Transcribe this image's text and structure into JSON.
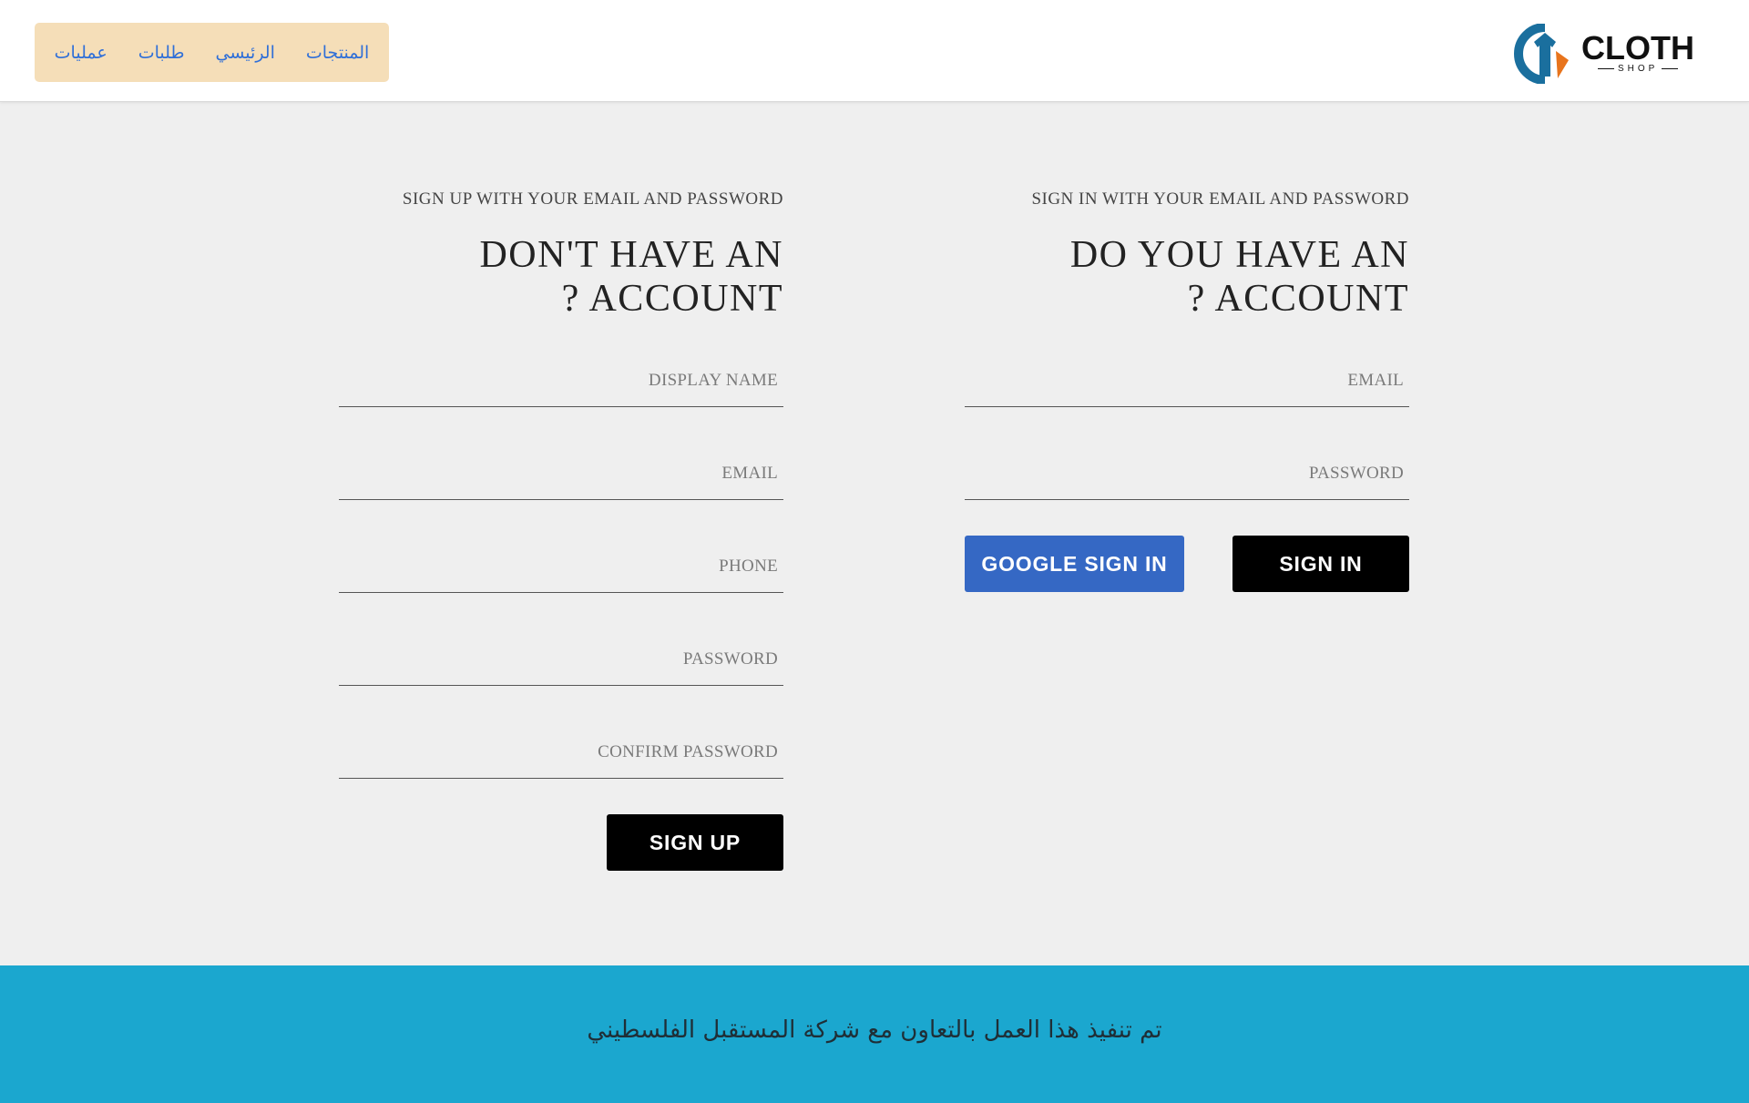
{
  "nav": {
    "items": [
      "عمليات",
      "طلبات",
      "الرئيسي",
      "المنتجات"
    ]
  },
  "logo": {
    "brand": "CLOTH",
    "sub": "SHOP",
    "icon": "shirt-hanger-logo-icon",
    "colors": {
      "blue": "#1a6f9e",
      "orange": "#e8741c"
    }
  },
  "signup": {
    "subtitle": "SIGN UP WITH YOUR EMAIL AND PASSWORD",
    "title_line1": "DON'T HAVE AN",
    "title_line2": "? ACCOUNT",
    "fields": {
      "display_name": {
        "placeholder": "DISPLAY NAME",
        "value": ""
      },
      "email": {
        "placeholder": "EMAIL",
        "value": ""
      },
      "phone": {
        "placeholder": "PHONE",
        "value": ""
      },
      "password": {
        "placeholder": "PASSWORD",
        "value": ""
      },
      "confirm_password": {
        "placeholder": "CONFIRM PASSWORD",
        "value": ""
      }
    },
    "button": "SIGN UP"
  },
  "signin": {
    "subtitle": "SIGN IN WITH YOUR EMAIL AND PASSWORD",
    "title_line1": "DO YOU HAVE AN",
    "title_line2": "? ACCOUNT",
    "fields": {
      "email": {
        "placeholder": "EMAIL",
        "value": ""
      },
      "password": {
        "placeholder": "PASSWORD",
        "value": ""
      }
    },
    "google_button": "GOOGLE SIGN IN",
    "button": "SIGN IN"
  },
  "footer": {
    "text": "تم تنفيذ هذا العمل بالتعاون مع شركة المستقبل الفلسطيني",
    "background": "#1ba7cf"
  },
  "colors": {
    "page_bg": "#efefef",
    "nav_bg": "#f5deb8",
    "nav_link": "#2f6fd8",
    "google_blue": "#3568c4",
    "black": "#000000"
  }
}
